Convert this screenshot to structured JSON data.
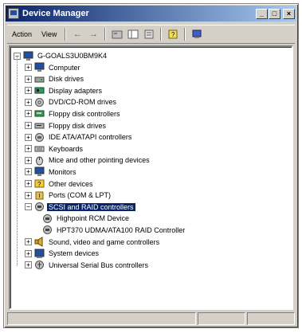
{
  "window": {
    "title": "Device Manager",
    "minimize": "_",
    "maximize": "□",
    "close": "×"
  },
  "toolbar": {
    "action_label": "Action",
    "view_label": "View"
  },
  "tree": {
    "root": "G-GOALS3U0BM9K4",
    "categories": [
      {
        "label": "Computer",
        "icon": "computer-icon"
      },
      {
        "label": "Disk drives",
        "icon": "disk-drive-icon"
      },
      {
        "label": "Display adapters",
        "icon": "display-adapter-icon"
      },
      {
        "label": "DVD/CD-ROM drives",
        "icon": "cdrom-icon"
      },
      {
        "label": "Floppy disk controllers",
        "icon": "floppy-controller-icon"
      },
      {
        "label": "Floppy disk drives",
        "icon": "floppy-drive-icon"
      },
      {
        "label": "IDE ATA/ATAPI controllers",
        "icon": "ide-controller-icon"
      },
      {
        "label": "Keyboards",
        "icon": "keyboard-icon"
      },
      {
        "label": "Mice and other pointing devices",
        "icon": "mouse-icon"
      },
      {
        "label": "Monitors",
        "icon": "monitor-icon"
      },
      {
        "label": "Other devices",
        "icon": "unknown-device-icon"
      },
      {
        "label": "Ports (COM & LPT)",
        "icon": "port-icon"
      },
      {
        "label": "SCSI and RAID controllers",
        "icon": "scsi-controller-icon",
        "selected": true,
        "expanded": true
      },
      {
        "label": "Sound, video and game controllers",
        "icon": "sound-icon"
      },
      {
        "label": "System devices",
        "icon": "system-device-icon"
      },
      {
        "label": "Universal Serial Bus controllers",
        "icon": "usb-icon"
      }
    ],
    "scsi_children": [
      {
        "label": "Highpoint RCM Device"
      },
      {
        "label": "HPT370 UDMA/ATA100 RAID Controller"
      }
    ]
  },
  "colors": {
    "titlebar_start": "#0a246a",
    "titlebar_end": "#a6caf0",
    "selection": "#0a246a",
    "window_face": "#d4d0c8"
  }
}
